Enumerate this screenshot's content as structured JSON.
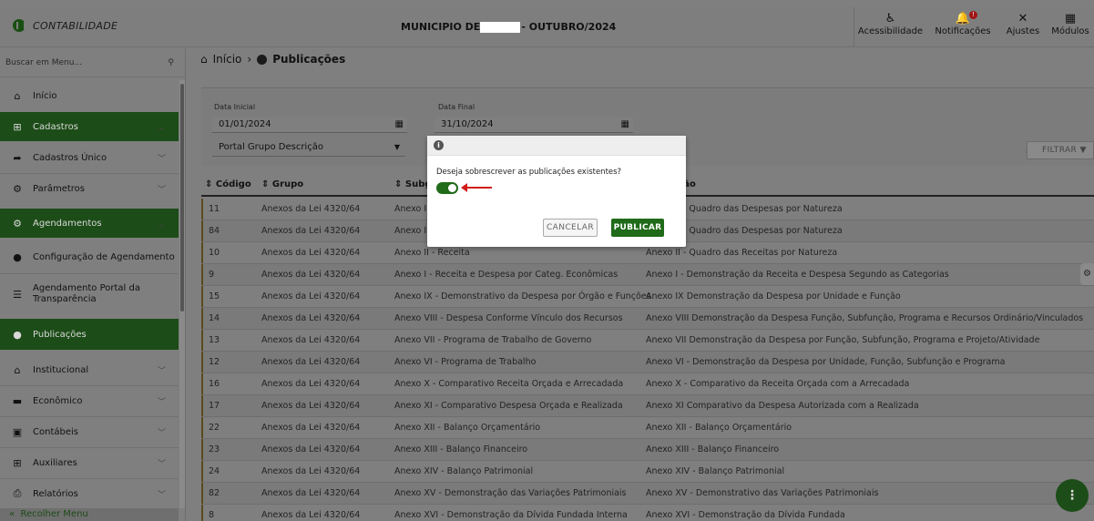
{
  "topbar": {
    "app_name": "CONTABILIDADE",
    "title_prefix": "MUNICIPIO DE",
    "title_suffix": "- OUTUBRO/2024",
    "actions": [
      {
        "label": "Acessibilidade",
        "icon": "accessibility-icon"
      },
      {
        "label": "Notificações",
        "icon": "bell-icon",
        "badge": "!"
      },
      {
        "label": "Ajustes",
        "icon": "tools-icon"
      },
      {
        "label": "Módulos",
        "icon": "grid-icon"
      }
    ]
  },
  "sidebar": {
    "search_placeholder": "Buscar em Menu...",
    "items": [
      {
        "label": "Início",
        "icon": "home-icon"
      },
      {
        "label": "Cadastros",
        "icon": "plus-box-icon"
      },
      {
        "label": "Cadastros Único",
        "icon": "share-icon"
      },
      {
        "label": "Parâmetros",
        "icon": "gears-icon"
      },
      {
        "label": "Agendamentos",
        "icon": "gears-icon"
      },
      {
        "label": "Configuração de Agendamento",
        "icon": "clock-icon"
      },
      {
        "label": "Agendamento Portal da Transparência",
        "icon": "list-icon"
      },
      {
        "label": "Publicações",
        "icon": "clock-icon"
      },
      {
        "label": "Institucional",
        "icon": "bank-icon"
      },
      {
        "label": "Econômico",
        "icon": "money-icon"
      },
      {
        "label": "Contábeis",
        "icon": "calculator-icon"
      },
      {
        "label": "Auxiliares",
        "icon": "plus-box-icon"
      },
      {
        "label": "Relatórios",
        "icon": "printer-icon"
      }
    ],
    "collapse_label": "Recolher Menu"
  },
  "breadcrumb": {
    "home": "Início",
    "separator": "›",
    "current": "Publicações"
  },
  "filters": {
    "start_label": "Data Inicial",
    "start_value": "01/01/2024",
    "end_label": "Data Final",
    "end_value": "31/10/2024",
    "select_value": "Portal Grupo Descrição",
    "required_mark": "*",
    "filter_button": "FILTRAR"
  },
  "table": {
    "headers": [
      "Código",
      "Grupo",
      "Subgrupo",
      "Descrição"
    ],
    "rows": [
      [
        "11",
        "Anexos da Lei 4320/64",
        "Anexo II",
        "Anexo II - Quadro das Despesas por Natureza"
      ],
      [
        "84",
        "Anexos da Lei 4320/64",
        "Anexo II",
        "Anexo II - Quadro das Despesas por Natureza"
      ],
      [
        "10",
        "Anexos da Lei 4320/64",
        "Anexo II - Receita",
        "Anexo II - Quadro das Receitas por Natureza"
      ],
      [
        "9",
        "Anexos da Lei 4320/64",
        "Anexo I - Receita e Despesa por Categ. Econômicas",
        "Anexo I - Demonstração da Receita e Despesa Segundo as Categorias"
      ],
      [
        "15",
        "Anexos da Lei 4320/64",
        "Anexo IX - Demonstrativo da Despesa por Órgão e Funções",
        "Anexo IX Demonstração da Despesa por Unidade e Função"
      ],
      [
        "14",
        "Anexos da Lei 4320/64",
        "Anexo VIII - Despesa Conforme Vínculo dos Recursos",
        "Anexo VIII Demonstração da Despesa Função, Subfunção, Programa e Recursos Ordinário/Vinculados"
      ],
      [
        "13",
        "Anexos da Lei 4320/64",
        "Anexo VII - Programa de Trabalho de Governo",
        "Anexo VII Demonstração da Despesa por Função, Subfunção, Programa e Projeto/Atividade"
      ],
      [
        "12",
        "Anexos da Lei 4320/64",
        "Anexo VI - Programa de Trabalho",
        "Anexo VI - Demonstração da Despesa por Unidade, Função, Subfunção e Programa"
      ],
      [
        "16",
        "Anexos da Lei 4320/64",
        "Anexo X - Comparativo Receita Orçada e Arrecadada",
        "Anexo X - Comparativo da Receita Orçada com a Arrecadada"
      ],
      [
        "17",
        "Anexos da Lei 4320/64",
        "Anexo XI - Comparativo Despesa Orçada e Realizada",
        "Anexo XI Comparativo da Despesa Autorizada com a Realizada"
      ],
      [
        "22",
        "Anexos da Lei 4320/64",
        "Anexo XII - Balanço Orçamentário",
        "Anexo XII - Balanço Orçamentário"
      ],
      [
        "23",
        "Anexos da Lei 4320/64",
        "Anexo XIII - Balanço Financeiro",
        "Anexo XIII - Balanço Financeiro"
      ],
      [
        "24",
        "Anexos da Lei 4320/64",
        "Anexo XIV - Balanço Patrimonial",
        "Anexo XIV - Balanço Patrimonial"
      ],
      [
        "82",
        "Anexos da Lei 4320/64",
        "Anexo XV - Demonstração das Variações Patrimoniais",
        "Anexo XV - Demonstrativo das Variações Patrimoniais"
      ],
      [
        "8",
        "Anexos da Lei 4320/64",
        "Anexo XVI - Demonstração da Dívida Fundada Interna",
        "Anexo XVI - Demonstração da Dívida Fundada"
      ]
    ]
  },
  "modal": {
    "question": "Deseja sobrescrever as publicações existentes?",
    "toggle_on": true,
    "cancel_label": "CANCELAR",
    "publish_label": "PUBLICAR"
  }
}
